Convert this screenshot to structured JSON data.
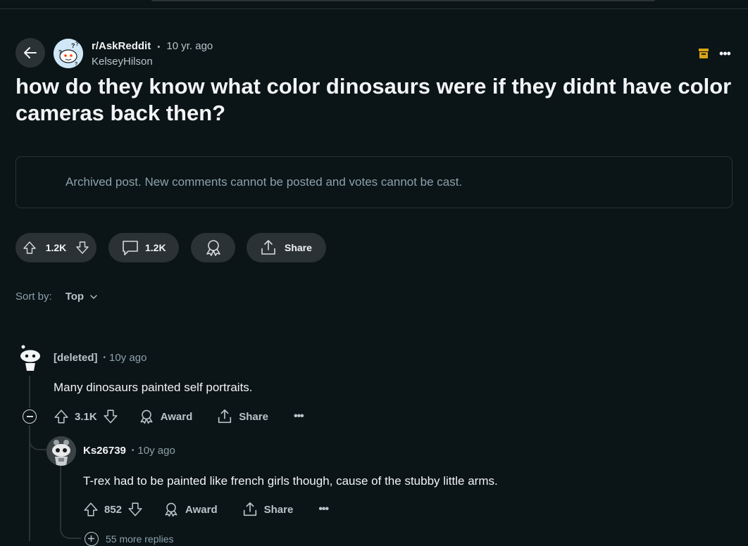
{
  "post": {
    "subreddit": "r/AskReddit",
    "separator": "•",
    "age": "10 yr. ago",
    "author": "KelseyHilson",
    "title": "how do they know what color dinosaurs were if they didnt have color cameras back then?",
    "archived_notice": "Archived post. New comments cannot be posted and votes cannot be cast.",
    "votes": "1.2K",
    "comments": "1.2K",
    "share_label": "Share",
    "overflow": "•••"
  },
  "sort": {
    "label": "Sort by:",
    "value": "Top"
  },
  "comments": [
    {
      "author": "[deleted]",
      "separator": "•",
      "age": "10y ago",
      "body": "Many dinosaurs painted self portraits.",
      "votes": "3.1K",
      "award_label": "Award",
      "share_label": "Share",
      "overflow": "•••"
    },
    {
      "author": "Ks26739",
      "separator": "•",
      "age": "10y ago",
      "body": "T-rex had to be painted like french girls though, cause of the stubby little arms.",
      "votes": "852",
      "award_label": "Award",
      "share_label": "Share",
      "overflow": "•••"
    }
  ],
  "more_replies": "55 more replies",
  "colors": {
    "background": "#0b1416",
    "pill": "#2a3236",
    "text": "#f2f4f5",
    "muted": "#8ba2ad",
    "archive_icon": "#d7a514"
  },
  "icons": {
    "back": "arrow-left-icon",
    "archive": "archive-icon",
    "upvote": "upvote-icon",
    "downvote": "downvote-icon",
    "comment": "comment-icon",
    "award": "award-icon",
    "share": "share-icon",
    "chevron": "chevron-down-icon",
    "collapse": "minus-circle-icon",
    "expand": "plus-circle-icon"
  }
}
